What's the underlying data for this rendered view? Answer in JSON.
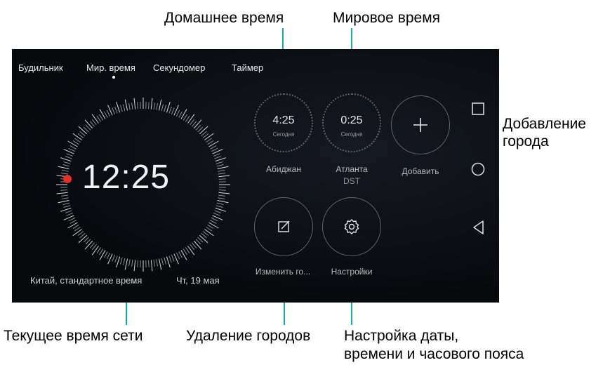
{
  "callouts": {
    "home_time": "Домашнее время",
    "world_time": "Мировое время",
    "add_city": "Добавление",
    "add_city_2": "города",
    "network_time": "Текущее время сети",
    "delete_cities": "Удаление городов",
    "settings_1": "Настройка даты,",
    "settings_2": "времени и часового пояса"
  },
  "tabs": [
    "Будильник",
    "Мир. время",
    "Секундомер",
    "Таймер"
  ],
  "active_tab": "Мир. время",
  "main_clock": {
    "time": "12:25",
    "zone": "Китай, стандартное время",
    "date": "Чт, 19 мая"
  },
  "cities": [
    {
      "time": "4:25",
      "day": "Сегодня",
      "name": "Абиджан",
      "extra": ""
    },
    {
      "time": "0:25",
      "day": "Сегодня",
      "name": "Атланта",
      "extra": "DST"
    }
  ],
  "actions": {
    "add_label": "Добавить",
    "edit_label": "Изменить го...",
    "settings_label": "Настройки"
  },
  "nav_icons": [
    "square-icon",
    "circle-icon",
    "back-triangle-icon"
  ],
  "colors": {
    "accent_line": "#18a9b8",
    "red_dot": "#e0322c",
    "background": "#07090d"
  }
}
